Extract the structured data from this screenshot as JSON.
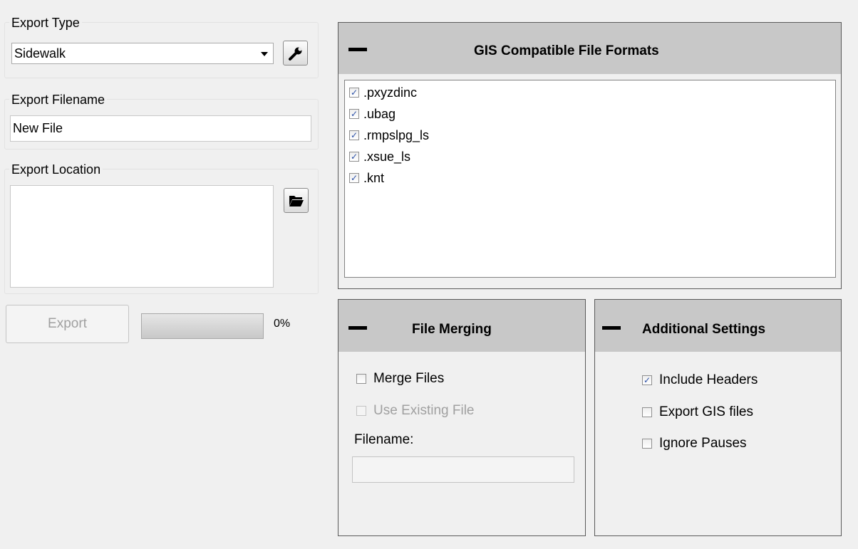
{
  "export_type": {
    "legend": "Export Type",
    "selected": "Sidewalk",
    "settings_icon": "wrench-icon"
  },
  "export_filename": {
    "legend": "Export Filename",
    "value": "New File"
  },
  "export_location": {
    "legend": "Export Location",
    "value": "",
    "browse_icon": "folder-open-icon"
  },
  "export_action": {
    "button_label": "Export",
    "progress_fraction": 0,
    "progress_text": "0%"
  },
  "gis_formats": {
    "title": "GIS Compatible File Formats",
    "items": [
      {
        "label": ".pxyzdinc",
        "checked": true
      },
      {
        "label": ".ubag",
        "checked": true
      },
      {
        "label": ".rmpslpg_ls",
        "checked": true
      },
      {
        "label": ".xsue_ls",
        "checked": true
      },
      {
        "label": ".knt",
        "checked": true
      }
    ]
  },
  "file_merging": {
    "title": "File Merging",
    "merge_files_label": "Merge Files",
    "merge_files_checked": false,
    "use_existing_label": "Use Existing File",
    "use_existing_checked": false,
    "filename_label": "Filename:",
    "filename_value": ""
  },
  "additional_settings": {
    "title": "Additional Settings",
    "include_headers_label": "Include Headers",
    "include_headers_checked": true,
    "export_gis_label": "Export GIS files",
    "export_gis_checked": false,
    "ignore_pauses_label": "Ignore Pauses",
    "ignore_pauses_checked": false
  },
  "colors": {
    "header_bg": "#c8c8c8",
    "window_bg": "#f0f0f0",
    "check_mark": "#2a4fa6",
    "disabled_text": "#a0a0a0"
  }
}
